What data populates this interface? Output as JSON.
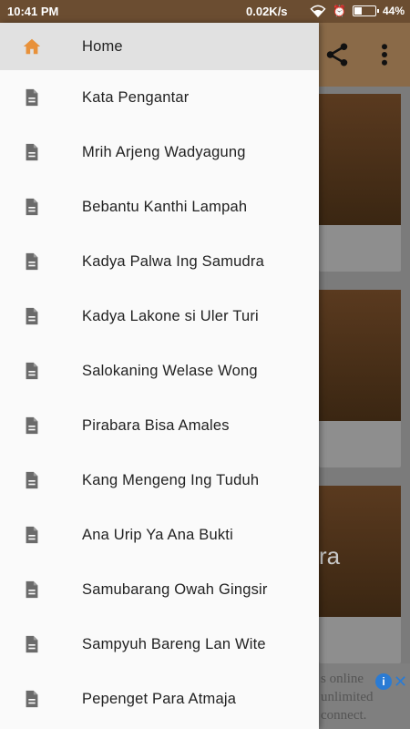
{
  "status_bar": {
    "time": "10:41 PM",
    "speed": "0.02K/s",
    "battery": "44%",
    "battery_level": 0.44
  },
  "toolbar": {
    "share_icon": "share-icon",
    "more_icon": "more-vert-icon"
  },
  "background_cards": {
    "card3_text": "ra"
  },
  "ad": {
    "line1": "s online",
    "line2": "unlimited",
    "line3": "connect.",
    "info_icon": "info-icon",
    "close_icon": "close-icon"
  },
  "drawer": {
    "items": [
      {
        "label": "Home",
        "icon": "home-icon",
        "active": true
      },
      {
        "label": "Kata Pengantar",
        "icon": "document-icon"
      },
      {
        "label": "Mrih Arjeng Wadyagung",
        "icon": "document-icon"
      },
      {
        "label": "Bebantu Kanthi Lampah",
        "icon": "document-icon"
      },
      {
        "label": "Kadya Palwa Ing Samudra",
        "icon": "document-icon"
      },
      {
        "label": "Kadya Lakone si Uler Turi",
        "icon": "document-icon"
      },
      {
        "label": "Salokaning Welase Wong",
        "icon": "document-icon"
      },
      {
        "label": "Pirabara Bisa Amales",
        "icon": "document-icon"
      },
      {
        "label": "Kang Mengeng Ing Tuduh",
        "icon": "document-icon"
      },
      {
        "label": "Ana Urip Ya Ana Bukti",
        "icon": "document-icon"
      },
      {
        "label": "Samubarang Owah Gingsir",
        "icon": "document-icon"
      },
      {
        "label": "Sampyuh Bareng Lan Wite",
        "icon": "document-icon"
      },
      {
        "label": "Pepenget Para Atmaja",
        "icon": "document-icon"
      }
    ]
  },
  "colors": {
    "accent": "#e8913a",
    "brand": "#8a6a48",
    "icon_gray": "#6a6a6a"
  }
}
